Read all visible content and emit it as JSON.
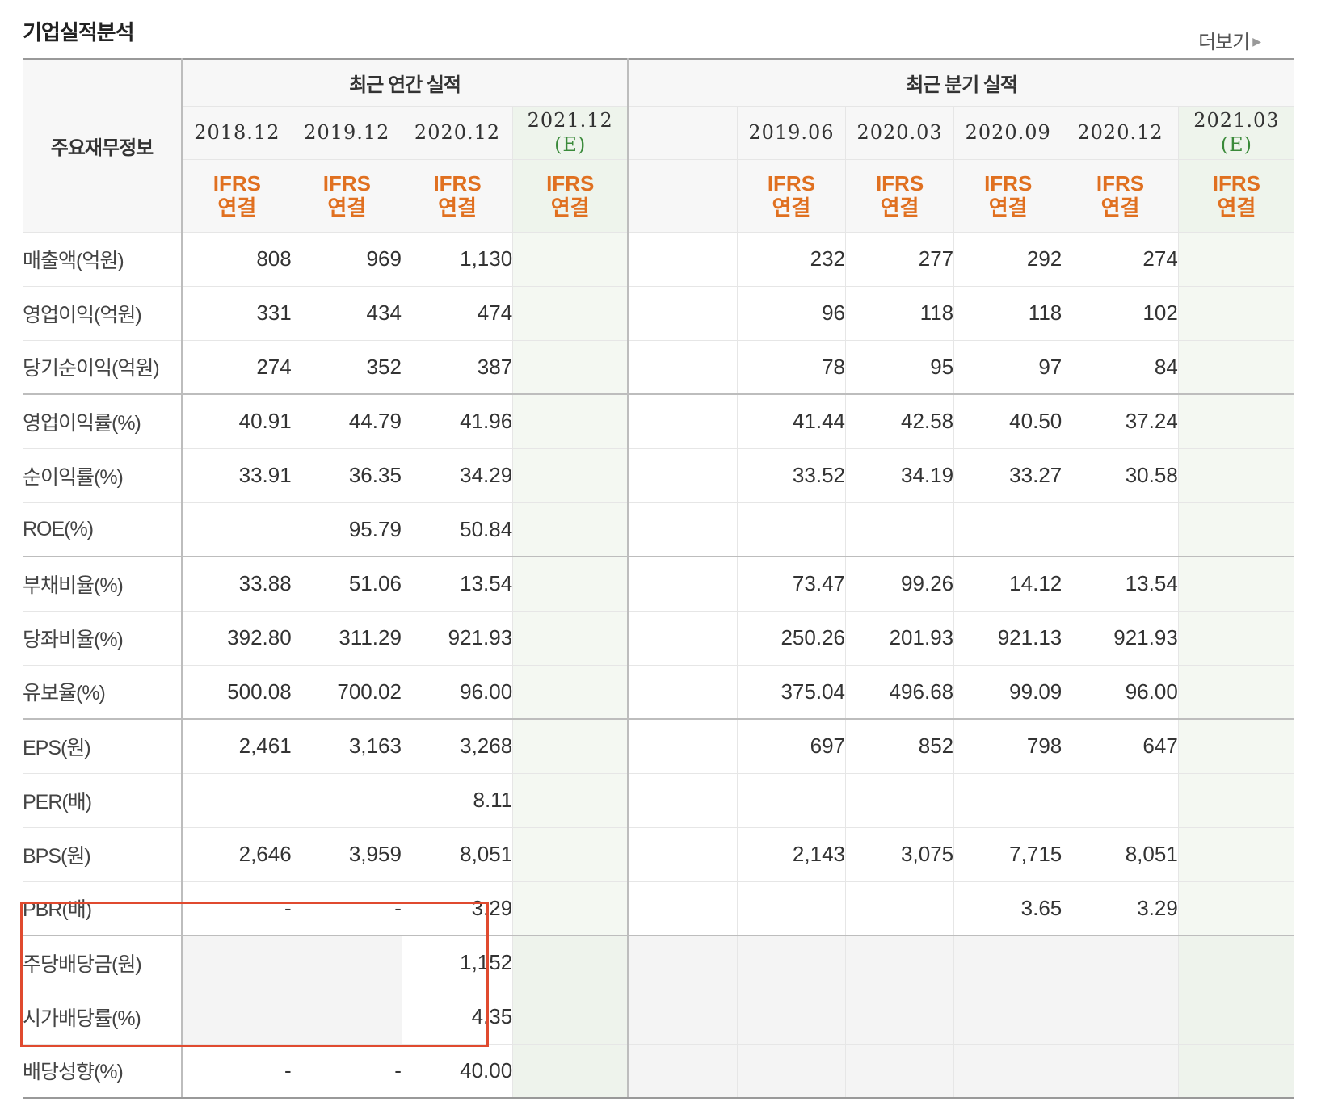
{
  "section": {
    "title": "기업실적분석",
    "more_label": "더보기"
  },
  "header": {
    "corner": "주요재무정보",
    "annual_group": "최근 연간 실적",
    "quarter_group": "최근 분기 실적",
    "annual_dates": [
      "2018.12",
      "2019.12",
      "2020.12",
      "2021.12"
    ],
    "quarter_dates": [
      "",
      "2019.06",
      "2020.03",
      "2020.09",
      "2020.12",
      "2021.03"
    ],
    "estimate_mark": "(E)",
    "ifrs_line1": "IFRS",
    "ifrs_line2": "연결"
  },
  "rows": [
    {
      "label": "매출액(억원)",
      "annual": [
        "808",
        "969",
        "1,130",
        ""
      ],
      "quarter": [
        "",
        "232",
        "277",
        "292",
        "274",
        ""
      ]
    },
    {
      "label": "영업이익(억원)",
      "annual": [
        "331",
        "434",
        "474",
        ""
      ],
      "quarter": [
        "",
        "96",
        "118",
        "118",
        "102",
        ""
      ]
    },
    {
      "label": "당기순이익(억원)",
      "annual": [
        "274",
        "352",
        "387",
        ""
      ],
      "quarter": [
        "",
        "78",
        "95",
        "97",
        "84",
        ""
      ]
    },
    {
      "label": "영업이익률(%)",
      "annual": [
        "40.91",
        "44.79",
        "41.96",
        ""
      ],
      "quarter": [
        "",
        "41.44",
        "42.58",
        "40.50",
        "37.24",
        ""
      ]
    },
    {
      "label": "순이익률(%)",
      "annual": [
        "33.91",
        "36.35",
        "34.29",
        ""
      ],
      "quarter": [
        "",
        "33.52",
        "34.19",
        "33.27",
        "30.58",
        ""
      ]
    },
    {
      "label": "ROE(%)",
      "annual": [
        "",
        "95.79",
        "50.84",
        ""
      ],
      "quarter": [
        "",
        "",
        "",
        "",
        "",
        ""
      ]
    },
    {
      "label": "부채비율(%)",
      "annual": [
        "33.88",
        "51.06",
        "13.54",
        ""
      ],
      "quarter": [
        "",
        "73.47",
        "99.26",
        "14.12",
        "13.54",
        ""
      ]
    },
    {
      "label": "당좌비율(%)",
      "annual": [
        "392.80",
        "311.29",
        "921.93",
        ""
      ],
      "quarter": [
        "",
        "250.26",
        "201.93",
        "921.13",
        "921.93",
        ""
      ]
    },
    {
      "label": "유보율(%)",
      "annual": [
        "500.08",
        "700.02",
        "96.00",
        ""
      ],
      "quarter": [
        "",
        "375.04",
        "496.68",
        "99.09",
        "96.00",
        ""
      ]
    },
    {
      "label": "EPS(원)",
      "annual": [
        "2,461",
        "3,163",
        "3,268",
        ""
      ],
      "quarter": [
        "",
        "697",
        "852",
        "798",
        "647",
        ""
      ]
    },
    {
      "label": "PER(배)",
      "annual": [
        "",
        "",
        "8.11",
        ""
      ],
      "quarter": [
        "",
        "",
        "",
        "",
        "",
        ""
      ]
    },
    {
      "label": "BPS(원)",
      "annual": [
        "2,646",
        "3,959",
        "8,051",
        ""
      ],
      "quarter": [
        "",
        "2,143",
        "3,075",
        "7,715",
        "8,051",
        ""
      ]
    },
    {
      "label": "PBR(배)",
      "annual": [
        "-",
        "-",
        "3.29",
        ""
      ],
      "quarter": [
        "",
        "",
        "",
        "3.65",
        "3.29",
        ""
      ]
    },
    {
      "label": "주당배당금(원)",
      "annual": [
        "",
        "",
        "1,152",
        ""
      ],
      "quarter": [
        "",
        "",
        "",
        "",
        "",
        ""
      ]
    },
    {
      "label": "시가배당률(%)",
      "annual": [
        "",
        "",
        "4.35",
        ""
      ],
      "quarter": [
        "",
        "",
        "",
        "",
        "",
        ""
      ]
    },
    {
      "label": "배당성향(%)",
      "annual": [
        "-",
        "-",
        "40.00",
        ""
      ],
      "quarter": [
        "",
        "",
        "",
        "",
        "",
        ""
      ]
    }
  ]
}
